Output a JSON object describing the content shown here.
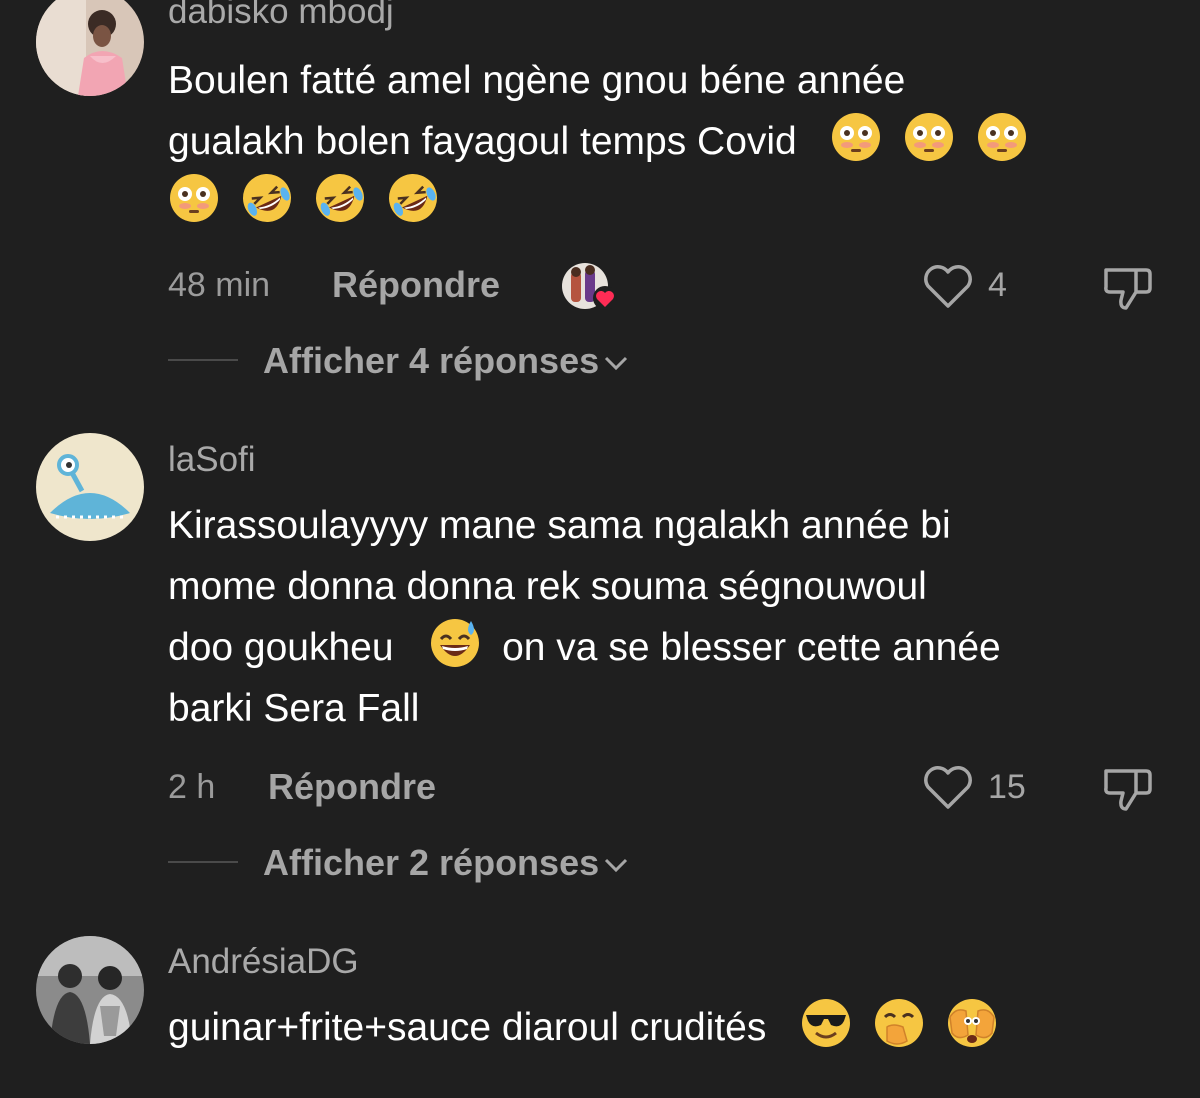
{
  "colors": {
    "background": "#1f1f1f",
    "text": "#ffffff",
    "muted": "#a6a6a6",
    "like_badge": "#fe2c55"
  },
  "comments": [
    {
      "username": "dabisko mbodj",
      "avatar": "avatar-photo-pink-dress",
      "text_lines": [
        "Boulen fatté amel ngène gnou béne année",
        "gualakh bolen fayagoul temps Covid"
      ],
      "emojis": [
        "flushed-face",
        "flushed-face",
        "flushed-face",
        "flushed-face",
        "rolling-laughing-face",
        "rolling-laughing-face",
        "rolling-laughing-face"
      ],
      "time": "48 min",
      "reply_label": "Répondre",
      "liked_by_creator": true,
      "like_count": "4",
      "view_replies": "Afficher 4 réponses"
    },
    {
      "username": "laSofi",
      "avatar": "alien-ufo-avatar",
      "text_parts": {
        "line1": "Kirassoulayyyy mane sama ngalakh année bi",
        "line2": "mome donna donna rek souma ségnouwoul",
        "line3_before": "doo goukheu",
        "line3_after": "on va se blesser cette année",
        "line4": "barki Sera Fall"
      },
      "emojis": [
        "sweat-smile-face"
      ],
      "time": "2 h",
      "reply_label": "Répondre",
      "like_count": "15",
      "view_replies": "Afficher 2 réponses"
    },
    {
      "username": "AndrésiaDG",
      "avatar": "avatar-photo-couple-bw",
      "text": "guinar+frite+sauce diaroul crudités",
      "emojis": [
        "sunglasses-face",
        "hand-over-mouth-face",
        "peeking-eyes-face"
      ]
    }
  ]
}
